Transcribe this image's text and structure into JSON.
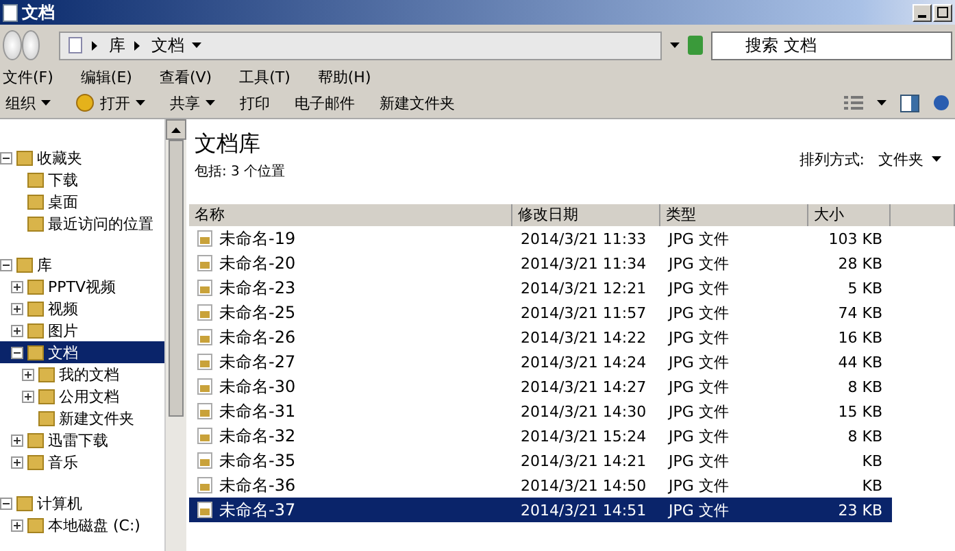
{
  "window": {
    "title": "文档"
  },
  "address": {
    "path": [
      {
        "label": "库"
      },
      {
        "label": "文档"
      }
    ]
  },
  "search": {
    "placeholder": "搜索 文档"
  },
  "menu": [
    {
      "label": "文件(F)"
    },
    {
      "label": "编辑(E)"
    },
    {
      "label": "查看(V)"
    },
    {
      "label": "工具(T)"
    },
    {
      "label": "帮助(H)"
    }
  ],
  "toolbar": [
    {
      "label": "组织",
      "dropdown": true,
      "icon": false
    },
    {
      "label": "打开",
      "dropdown": true,
      "icon": true
    },
    {
      "label": "共享",
      "dropdown": true,
      "icon": false
    },
    {
      "label": "打印",
      "dropdown": false,
      "icon": false
    },
    {
      "label": "电子邮件",
      "dropdown": false,
      "icon": false
    },
    {
      "label": "新建文件夹",
      "dropdown": false,
      "icon": false
    }
  ],
  "sidebar": {
    "groups": [
      {
        "label": "收藏夹",
        "expanded": true,
        "selected": false,
        "children": [
          {
            "label": "下载",
            "selected": false
          },
          {
            "label": "桌面",
            "selected": false
          },
          {
            "label": "最近访问的位置",
            "selected": false
          }
        ]
      },
      {
        "label": "库",
        "expanded": true,
        "selected": false,
        "children": [
          {
            "label": "PPTV视频",
            "expanded": false,
            "selected": false
          },
          {
            "label": "视频",
            "expanded": false,
            "selected": false
          },
          {
            "label": "图片",
            "expanded": false,
            "selected": false
          },
          {
            "label": "文档",
            "expanded": true,
            "selected": true,
            "children": [
              {
                "label": "我的文档",
                "expanded": false,
                "selected": false
              },
              {
                "label": "公用文档",
                "expanded": false,
                "selected": false
              },
              {
                "label": "新建文件夹",
                "selected": false
              }
            ]
          },
          {
            "label": "迅雷下载",
            "expanded": false,
            "selected": false
          },
          {
            "label": "音乐",
            "expanded": false,
            "selected": false
          }
        ]
      },
      {
        "label": "计算机",
        "expanded": true,
        "selected": false,
        "children": [
          {
            "label": "本地磁盘 (C:)",
            "expanded": false,
            "selected": false
          }
        ]
      }
    ]
  },
  "library": {
    "title": "文档库",
    "subtitle": "包括: 3 个位置",
    "arrange_label": "排列方式:",
    "arrange_value": "文件夹"
  },
  "table": {
    "columns": [
      "名称",
      "修改日期",
      "类型",
      "大小"
    ],
    "rows": [
      {
        "name": "未命名-19",
        "date": "2014/3/21 11:33",
        "type": "JPG 文件",
        "size": "103 KB",
        "selected": false
      },
      {
        "name": "未命名-20",
        "date": "2014/3/21 11:34",
        "type": "JPG 文件",
        "size": "28 KB",
        "selected": false
      },
      {
        "name": "未命名-23",
        "date": "2014/3/21 12:21",
        "type": "JPG 文件",
        "size": "5 KB",
        "selected": false
      },
      {
        "name": "未命名-25",
        "date": "2014/3/21 11:57",
        "type": "JPG 文件",
        "size": "74 KB",
        "selected": false
      },
      {
        "name": "未命名-26",
        "date": "2014/3/21 14:22",
        "type": "JPG 文件",
        "size": "16 KB",
        "selected": false
      },
      {
        "name": "未命名-27",
        "date": "2014/3/21 14:24",
        "type": "JPG 文件",
        "size": "44 KB",
        "selected": false
      },
      {
        "name": "未命名-30",
        "date": "2014/3/21 14:27",
        "type": "JPG 文件",
        "size": "8 KB",
        "selected": false
      },
      {
        "name": "未命名-31",
        "date": "2014/3/21 14:30",
        "type": "JPG 文件",
        "size": "15 KB",
        "selected": false
      },
      {
        "name": "未命名-32",
        "date": "2014/3/21 15:24",
        "type": "JPG 文件",
        "size": "8 KB",
        "selected": false
      },
      {
        "name": "未命名-35",
        "date": "2014/3/21 14:21",
        "type": "JPG 文件",
        "size": "KB",
        "selected": false
      },
      {
        "name": "未命名-36",
        "date": "2014/3/21 14:50",
        "type": "JPG 文件",
        "size": "KB",
        "selected": false
      },
      {
        "name": "未命名-37",
        "date": "2014/3/21 14:51",
        "type": "JPG 文件",
        "size": "23 KB",
        "selected": true
      }
    ]
  }
}
